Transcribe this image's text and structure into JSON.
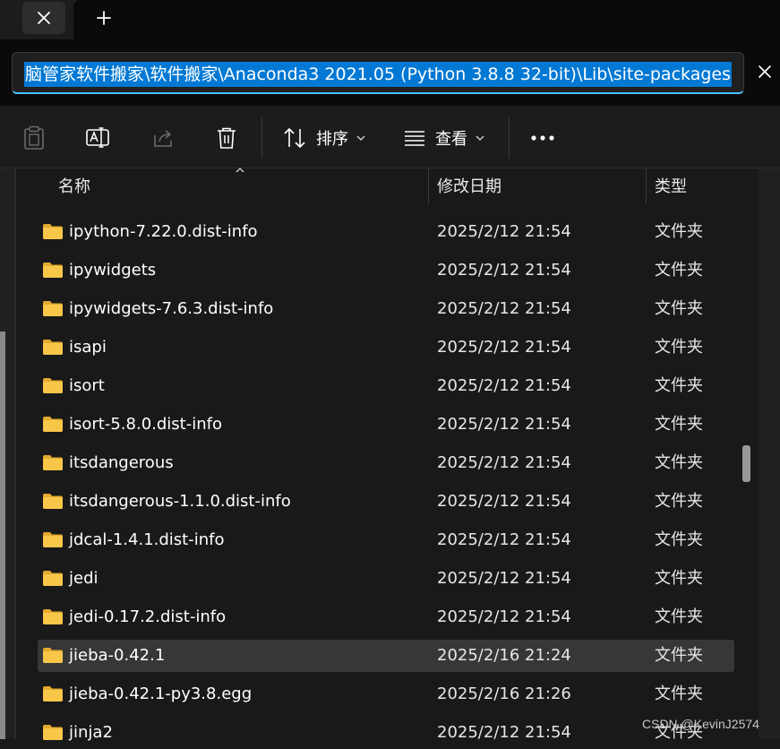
{
  "address": {
    "path": "脑管家软件搬家\\软件搬家\\Anaconda3 2021.05 (Python 3.8.8 32-bit)\\Lib\\site-packages"
  },
  "toolbar": {
    "sort_label": "排序",
    "view_label": "查看",
    "more_label": "•••"
  },
  "columns": {
    "name": "名称",
    "date": "修改日期",
    "type": "类型"
  },
  "rows": [
    {
      "name": "ipython-7.22.0.dist-info",
      "date": "2025/2/12 21:54",
      "type": "文件夹"
    },
    {
      "name": "ipywidgets",
      "date": "2025/2/12 21:54",
      "type": "文件夹"
    },
    {
      "name": "ipywidgets-7.6.3.dist-info",
      "date": "2025/2/12 21:54",
      "type": "文件夹"
    },
    {
      "name": "isapi",
      "date": "2025/2/12 21:54",
      "type": "文件夹"
    },
    {
      "name": "isort",
      "date": "2025/2/12 21:54",
      "type": "文件夹"
    },
    {
      "name": "isort-5.8.0.dist-info",
      "date": "2025/2/12 21:54",
      "type": "文件夹"
    },
    {
      "name": "itsdangerous",
      "date": "2025/2/12 21:54",
      "type": "文件夹"
    },
    {
      "name": "itsdangerous-1.1.0.dist-info",
      "date": "2025/2/12 21:54",
      "type": "文件夹"
    },
    {
      "name": "jdcal-1.4.1.dist-info",
      "date": "2025/2/12 21:54",
      "type": "文件夹"
    },
    {
      "name": "jedi",
      "date": "2025/2/12 21:54",
      "type": "文件夹"
    },
    {
      "name": "jedi-0.17.2.dist-info",
      "date": "2025/2/12 21:54",
      "type": "文件夹"
    },
    {
      "name": "jieba-0.42.1",
      "date": "2025/2/16 21:24",
      "type": "文件夹",
      "selected": true
    },
    {
      "name": "jieba-0.42.1-py3.8.egg",
      "date": "2025/2/16 21:26",
      "type": "文件夹"
    },
    {
      "name": "jinja2",
      "date": "2025/2/12 21:54",
      "type": "文件夹"
    }
  ],
  "watermark": "CSDN @KevinJ2574",
  "colors": {
    "accent": "#0078d4",
    "folder": "#f8c74a",
    "selected_row": "#373737"
  }
}
